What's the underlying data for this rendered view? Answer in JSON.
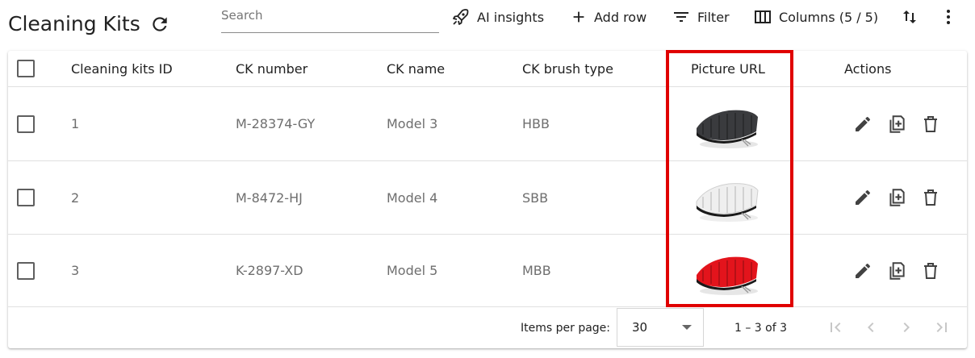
{
  "header": {
    "title": "Cleaning Kits",
    "refresh_icon": "refresh-icon",
    "search": {
      "placeholder": "Search",
      "value": ""
    },
    "toolbar": {
      "ai_insights_label": "AI insights",
      "add_row_label": "Add row",
      "filter_label": "Filter",
      "columns_label": "Columns (5 / 5)"
    }
  },
  "table": {
    "columns": [
      "Cleaning kits ID",
      "CK number",
      "CK name",
      "CK brush type",
      "Picture URL",
      "Actions"
    ],
    "rows": [
      {
        "id": "1",
        "ck_number": "M-28374-GY",
        "ck_name": "Model 3",
        "brush_type": "HBB",
        "picture_color": "#3a3b3e"
      },
      {
        "id": "2",
        "ck_number": "M-8472-HJ",
        "ck_name": "Model 4",
        "brush_type": "SBB",
        "picture_color": "#efefef"
      },
      {
        "id": "3",
        "ck_number": "K-2897-XD",
        "ck_name": "Model 5",
        "brush_type": "MBB",
        "picture_color": "#e3141c"
      }
    ]
  },
  "footer": {
    "items_per_page_label": "Items per page:",
    "items_per_page_value": "30",
    "range": "1 – 3 of 3"
  },
  "colors": {
    "highlight": "#e00000",
    "icon": "#424242",
    "disabled": "#c7c7c7"
  }
}
